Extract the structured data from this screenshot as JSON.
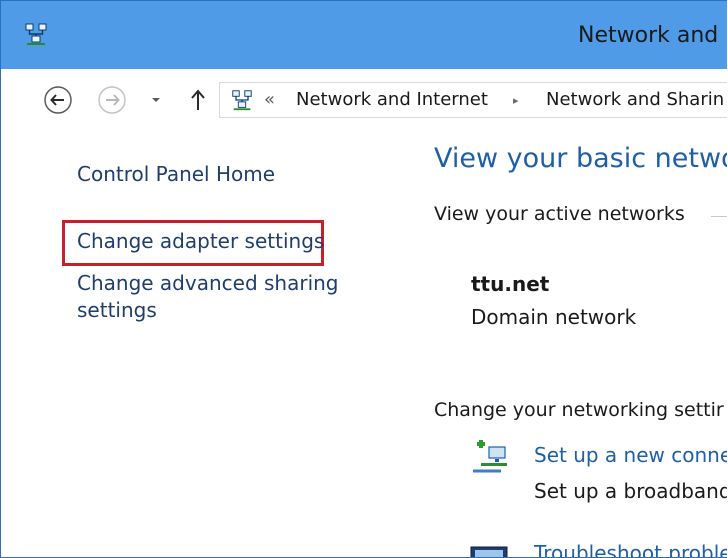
{
  "window": {
    "title": "Network and",
    "title_icon": "network-sharing-icon"
  },
  "navigation": {
    "back_icon": "back-arrow-icon",
    "forward_icon": "forward-arrow-icon",
    "recent_icon": "dropdown-arrow-icon",
    "up_icon": "up-arrow-icon"
  },
  "address_bar": {
    "overflow_glyph": "«",
    "crumbs": [
      "Network and Internet",
      "Network and Sharin"
    ],
    "separator_glyph": "▸"
  },
  "left_pane": {
    "links": [
      "Control Panel Home",
      "Change adapter settings",
      "Change advanced sharing",
      "settings"
    ]
  },
  "main": {
    "heading": "View your basic networ",
    "active_networks_label": "View your active networks",
    "network_name": "ttu.net",
    "network_type": "Domain network",
    "change_settings_label": "Change your networking settir",
    "tasks": [
      {
        "link": "Set up a new connec",
        "desc": "Set up a broadband,",
        "icon": "new-connection-icon"
      },
      {
        "link": "Troubleshoot proble",
        "icon": "troubleshoot-icon"
      }
    ]
  },
  "colors": {
    "titlebar": "#4f9be7",
    "link": "#1f3e6e",
    "heading": "#1f5fa8",
    "highlight": "#c8202a"
  }
}
